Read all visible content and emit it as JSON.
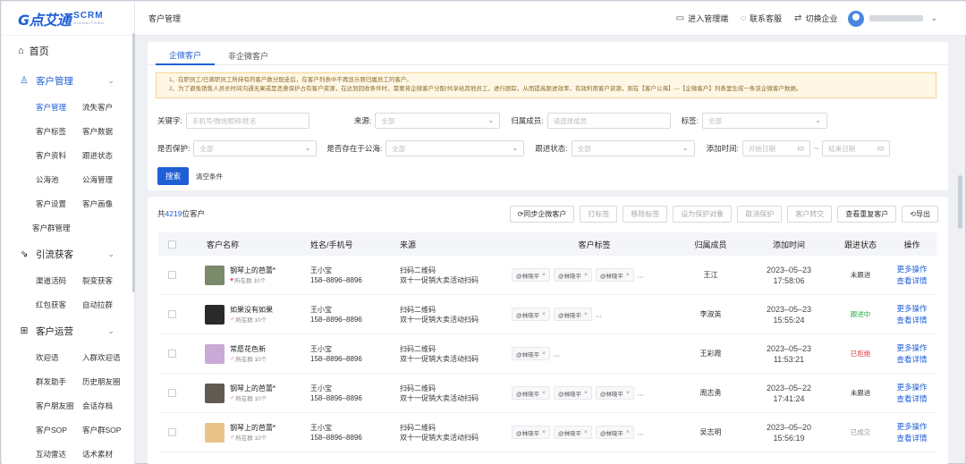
{
  "logo": {
    "main": "点艾通",
    "mark": "G",
    "scrm": "SCRM",
    "sub": "DIANAITONG"
  },
  "header": {
    "title": "客户管理",
    "actions": [
      {
        "icon": "monitor-icon",
        "glyph": "▭",
        "label": "进入管理端"
      },
      {
        "icon": "headset-icon",
        "glyph": "◌",
        "label": "联系客服"
      },
      {
        "icon": "switch-icon",
        "glyph": "⇄",
        "label": "切换企业"
      }
    ]
  },
  "sidebar": {
    "home": "首页",
    "groups": [
      {
        "label": "客户管理",
        "icon": "user-icon",
        "glyph": "♙",
        "active": true,
        "rows": [
          [
            "客户管理",
            "流失客户"
          ],
          [
            "客户标签",
            "客户数据"
          ],
          [
            "客户资料",
            "跟进状态"
          ],
          [
            "公海池",
            "公海管理"
          ],
          [
            "客户设置",
            "客户画像"
          ]
        ],
        "single": "客户群管理"
      },
      {
        "label": "引流获客",
        "icon": "funnel-icon",
        "glyph": "⇘",
        "active": false,
        "rows": [
          [
            "渠道活码",
            "裂变获客"
          ],
          [
            "红包获客",
            "自动拉群"
          ]
        ]
      },
      {
        "label": "客户运营",
        "icon": "grid-icon",
        "glyph": "⊞",
        "active": false,
        "rows": [
          [
            "欢迎语",
            "入群欢迎语"
          ],
          [
            "群发助手",
            "历史朋友圈"
          ],
          [
            "客户朋友圈",
            "会话存档"
          ],
          [
            "客户SOP",
            "客户群SOP"
          ],
          [
            "互动雷达",
            "话术素材"
          ]
        ]
      }
    ]
  },
  "tabs": [
    "企微客户",
    "非企微客户"
  ],
  "notice": [
    "1、在职员工/已离职员工所持有的客户数分配走后，在客户列表中不再显示原归属员工的客户。",
    "2、为了避免销售人员长时间沟通无果或是恶意保护占有客户资源，在达到回收条件时，需要将企微客户分配/共享给其他员工，进行跟踪，从而提高跟进效率，有效利用客户资源，则在【客户公海】---【企微客户】列表里生成一条该企微客户数据。"
  ],
  "filters": {
    "keyword_label": "关键字:",
    "keyword_ph": "手机号/微信昵称/姓名",
    "source_label": "来源:",
    "source_ph": "全部",
    "owner_label": "归属成员:",
    "owner_ph": "请选择成员",
    "tag_label": "标签:",
    "tag_ph": "全部",
    "protect_label": "是否保护:",
    "protect_ph": "全部",
    "pool_label": "是否存在于公海:",
    "pool_ph": "全部",
    "follow_label": "跟进状态:",
    "follow_ph": "全部",
    "time_label": "添加时间:",
    "start_ph": "开始日期",
    "sep": "~",
    "end_ph": "结束日期",
    "search_btn": "搜索",
    "clear_btn": "清空条件"
  },
  "toolbar": {
    "count_prefix": "共",
    "count": "4219",
    "count_suffix": "位客户",
    "buttons": [
      {
        "label": "同步企微客户",
        "enabled": true,
        "icon": "sync-icon"
      },
      {
        "label": "打标签",
        "enabled": false
      },
      {
        "label": "移除标签",
        "enabled": false
      },
      {
        "label": "设为保护对象",
        "enabled": false
      },
      {
        "label": "取消保护",
        "enabled": false
      },
      {
        "label": "客户转交",
        "enabled": false
      },
      {
        "label": "查看重复客户",
        "enabled": true
      },
      {
        "label": "导出",
        "enabled": true,
        "icon": "export-icon"
      }
    ]
  },
  "table": {
    "columns": [
      "客户名称",
      "姓名/手机号",
      "来源",
      "客户标签",
      "归属成员",
      "添加时间",
      "跟进状态",
      "操作"
    ],
    "op_more": "更多操作",
    "op_detail": "查看详情",
    "rows": [
      {
        "name": "钢琴上的芭蕾*",
        "group": "所在群 10个",
        "gicon": "pin",
        "avatar": "#7a8a6a",
        "person": "王小宝",
        "phone": "158–8896–8896",
        "src1": "扫码二维码",
        "src2": "双十一促销大卖活动扫码",
        "tags": [
          "@林晓平",
          "@林晓平",
          "@林晓平"
        ],
        "owner": "王江",
        "date": "2023–05–23",
        "time": "17:58:06",
        "status": "未跟进",
        "status_color": "#333333"
      },
      {
        "name": "如果没有如果",
        "group": "所在群 10个",
        "gicon": "gender",
        "avatar": "#2a2a2a",
        "person": "王小宝",
        "phone": "158–8896–8896",
        "src1": "扫码二维码",
        "src2": "双十一促销大卖活动扫码",
        "tags": [
          "@林晓平",
          "@林晓平"
        ],
        "owner": "李淑英",
        "date": "2023–05–23",
        "time": "15:55:24",
        "status": "跟进中",
        "status_color": "#2ba84a"
      },
      {
        "name": "常愿花色新",
        "group": "所在群 10个",
        "gicon": "gender",
        "avatar": "#c9a9d6",
        "person": "王小宝",
        "phone": "158–8896–8896",
        "src1": "扫码二维码",
        "src2": "双十一促销大卖活动扫码",
        "tags": [
          "@林晓平"
        ],
        "owner": "王彩霞",
        "date": "2023–05–23",
        "time": "11:53:21",
        "status": "已拒绝",
        "status_color": "#e23c3c"
      },
      {
        "name": "钢琴上的芭蕾*",
        "group": "所在群 10个",
        "gicon": "gender",
        "avatar": "#5f5a52",
        "person": "王小宝",
        "phone": "158–8896–8896",
        "src1": "扫码二维码",
        "src2": "双十一促销大卖活动扫码",
        "tags": [
          "@林晓平",
          "@林晓平",
          "@林晓平"
        ],
        "owner": "周志勇",
        "date": "2023–05–22",
        "time": "17:41:24",
        "status": "未跟进",
        "status_color": "#333333"
      },
      {
        "name": "钢琴上的芭蕾*",
        "group": "所在群 10个",
        "gicon": "gender",
        "avatar": "#e8c48a",
        "person": "王小宝",
        "phone": "158–8896–8896",
        "src1": "扫码二维码",
        "src2": "双十一促销大卖活动扫码",
        "tags": [
          "@林晓平",
          "@林晓平",
          "@林晓平"
        ],
        "owner": "吴志明",
        "date": "2023–05–20",
        "time": "15:56:19",
        "status": "已成交",
        "status_color": "#999999"
      }
    ]
  }
}
